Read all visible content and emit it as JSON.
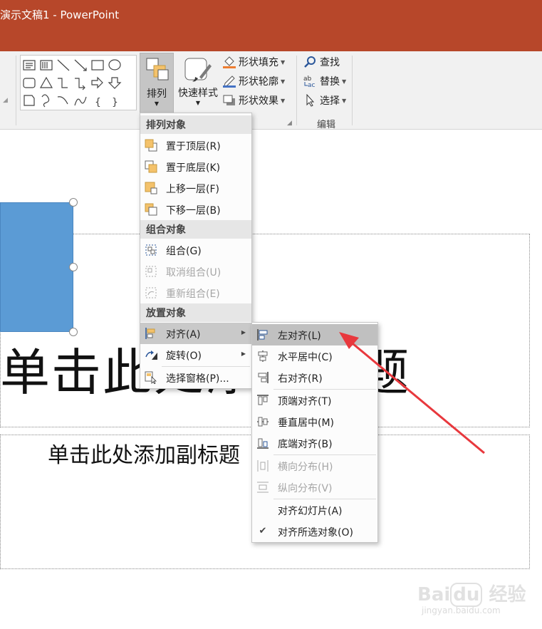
{
  "window": {
    "title": "演示文稿1 - PowerPoint"
  },
  "ribbon": {
    "arrange_label": "排列",
    "quick_styles_label": "快速样式",
    "shape_fill": "形状填充",
    "shape_outline": "形状轮廓",
    "shape_effects": "形状效果",
    "find": "查找",
    "replace": "替换",
    "select": "选择",
    "editing_group": "编辑"
  },
  "slide": {
    "title_placeholder": "单击此处添加标题",
    "subtitle_placeholder": "单击此处添加副标题"
  },
  "arrange_menu": {
    "headers": [
      "排列对象",
      "组合对象",
      "放置对象"
    ],
    "items": [
      {
        "label": "置于顶层(R)",
        "enabled": true
      },
      {
        "label": "置于底层(K)",
        "enabled": true
      },
      {
        "label": "上移一层(F)",
        "enabled": true
      },
      {
        "label": "下移一层(B)",
        "enabled": true
      },
      {
        "label": "组合(G)",
        "enabled": true
      },
      {
        "label": "取消组合(U)",
        "enabled": false
      },
      {
        "label": "重新组合(E)",
        "enabled": false
      },
      {
        "label": "对齐(A)",
        "enabled": true,
        "highlighted": true,
        "submenu": true
      },
      {
        "label": "旋转(O)",
        "enabled": true,
        "submenu": true
      },
      {
        "label": "选择窗格(P)...",
        "enabled": true
      }
    ]
  },
  "align_menu": {
    "items": [
      {
        "label": "左对齐(L)",
        "enabled": true,
        "highlighted": true
      },
      {
        "label": "水平居中(C)",
        "enabled": true
      },
      {
        "label": "右对齐(R)",
        "enabled": true
      },
      {
        "label": "顶端对齐(T)",
        "enabled": true
      },
      {
        "label": "垂直居中(M)",
        "enabled": true
      },
      {
        "label": "底端对齐(B)",
        "enabled": true
      },
      {
        "label": "横向分布(H)",
        "enabled": false
      },
      {
        "label": "纵向分布(V)",
        "enabled": false
      },
      {
        "label": "对齐幻灯片(A)",
        "enabled": true
      },
      {
        "label": "对齐所选对象(O)",
        "enabled": true,
        "checked": true
      }
    ]
  },
  "watermark": {
    "brand": "Bai 经验",
    "url": "jingyan.baidu.com"
  },
  "colors": {
    "titlebar": "#b7472a",
    "shape_fill": "#5b9bd5",
    "annotation_arrow": "#e8383d"
  }
}
